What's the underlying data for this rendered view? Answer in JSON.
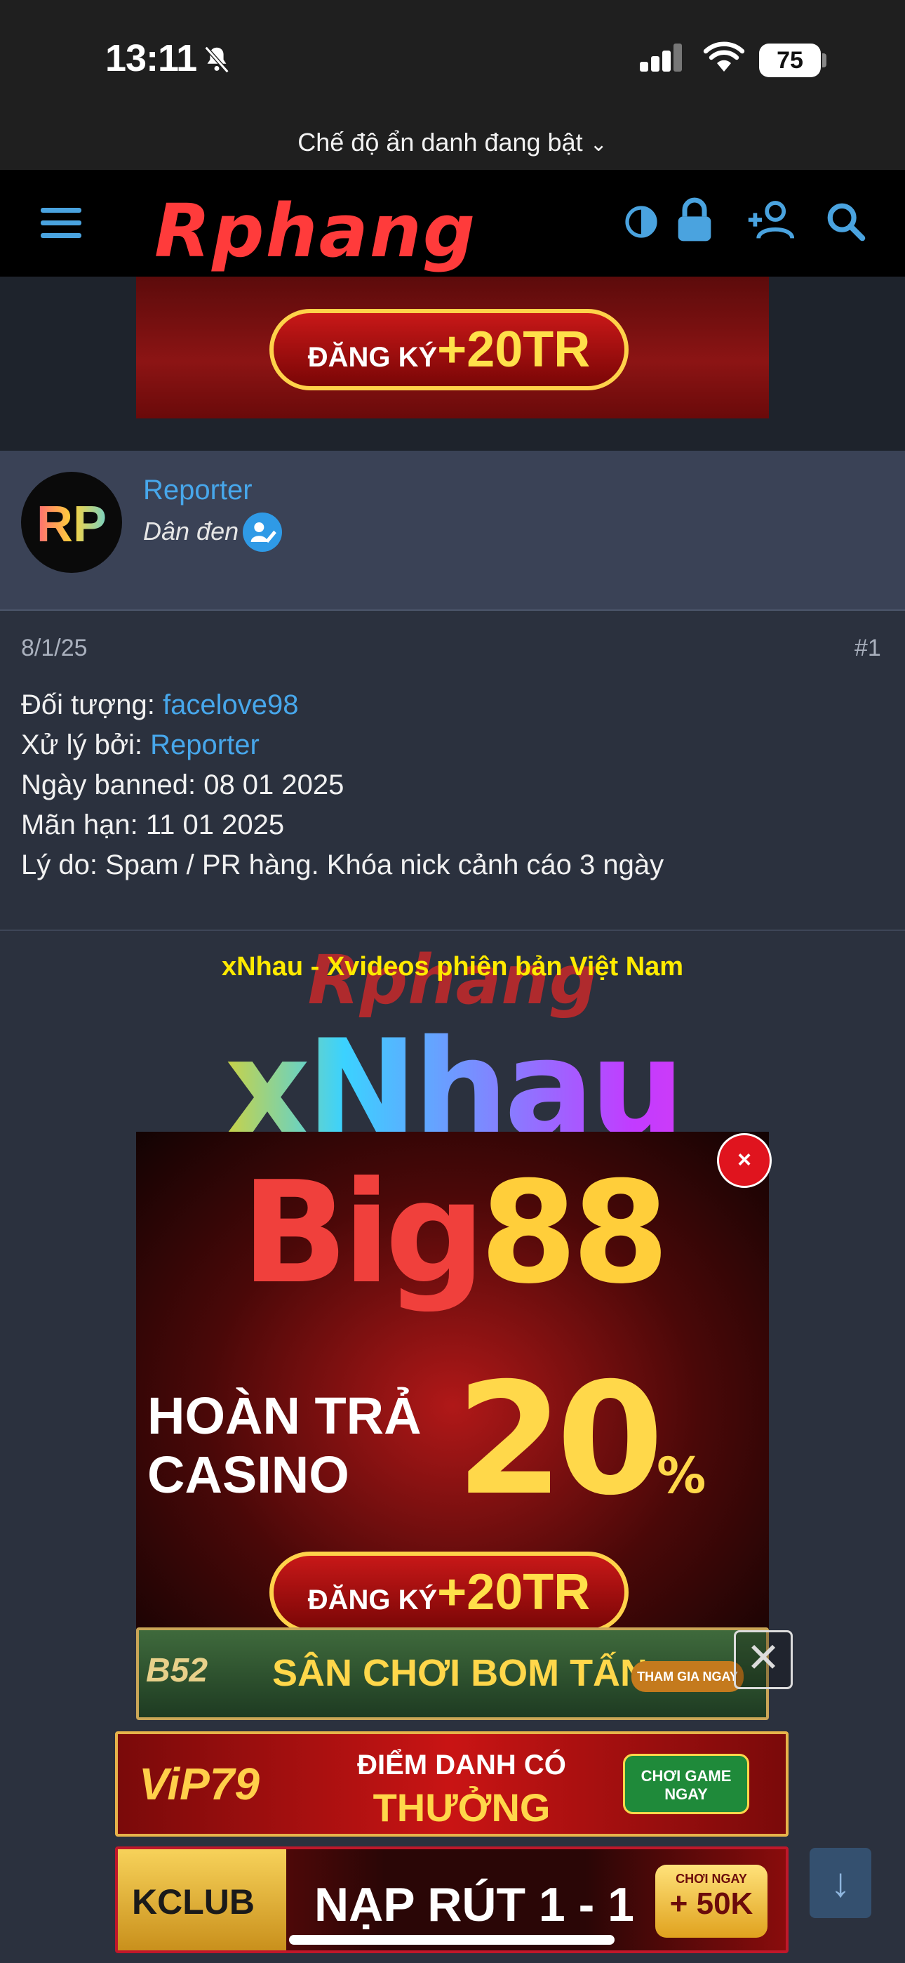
{
  "status_bar": {
    "time": "13:11",
    "battery": "75",
    "incognito_label": "Chế độ ẩn danh đang bật"
  },
  "header": {
    "logo_text": "Rphang",
    "icons": [
      "menu-icon",
      "theme-toggle-icon",
      "lock-icon",
      "add-user-icon",
      "search-icon"
    ]
  },
  "top_ad": {
    "register_label": "ĐĂNG KÝ",
    "register_amount": "+20TR"
  },
  "post": {
    "author": {
      "avatar_initials": "RP",
      "name": "Reporter",
      "title": "Dân đen"
    },
    "date": "8/1/25",
    "number": "#1",
    "lines": {
      "target_label": "Đối tượng: ",
      "target_value": "facelove98",
      "handled_label": "Xử lý bởi: ",
      "handled_value": "Reporter",
      "banned_date": "Ngày banned: 08 01 2025",
      "expiry": "Mãn hạn: 11 01 2025",
      "reason": "Lý do: Spam / PR hàng. Khóa nick cảnh cáo 3 ngày"
    }
  },
  "promo": {
    "tagline": "xNhau - Xvideos phiên bản Việt Nam",
    "logo": "xNhau",
    "watermark": "Rphang"
  },
  "big88_ad": {
    "brand_a": "Big",
    "brand_b": "88",
    "line1": "HOÀN TRẢ",
    "line2": "CASINO",
    "percent": "20",
    "percent_sign": "%",
    "register_label": "ĐĂNG KÝ",
    "register_amount": "+20TR",
    "close_label": "×"
  },
  "banners": {
    "b52": {
      "brand": "B52",
      "text": "SÂN CHƠI BOM TẤN",
      "cta": "THAM GIA NGAY",
      "close_label": "✕"
    },
    "vip79": {
      "brand": "ViP79",
      "text_top": "ĐIỂM DANH CÓ",
      "text_bottom": "THƯỞNG",
      "cta": "CHƠI GAME NGAY"
    },
    "kclub": {
      "brand": "KCLUB",
      "text": "NẠP RÚT 1 - 1",
      "cta_small": "CHƠI NGAY",
      "cta_big": "+ 50K"
    }
  },
  "scroll_down_label": "↓",
  "colors": {
    "accent": "#47a7eb",
    "page_bg": "#2b313e",
    "author_bg": "#3a4256",
    "header_bg": "#000000",
    "tagline": "#ffea00"
  }
}
